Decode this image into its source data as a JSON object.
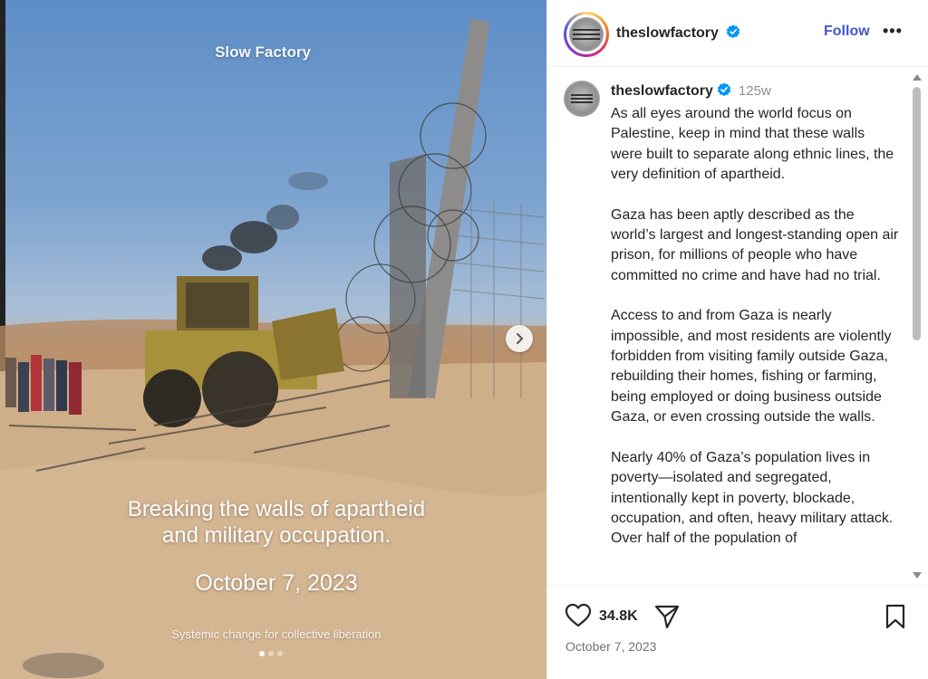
{
  "media": {
    "brand": "Slow Factory",
    "headline": "Breaking the walls of apartheid\nand military occupation.",
    "date": "October 7, 2023",
    "subtitle": "Systemic change for collective liberation",
    "carousel": {
      "count": 3,
      "active_index": 0
    }
  },
  "header": {
    "username": "theslowfactory",
    "verified": true,
    "follow_label": "Follow",
    "more_label": "•••"
  },
  "caption": {
    "username": "theslowfactory",
    "time": "125w",
    "paragraphs": [
      "As all eyes around the world focus on Palestine, keep in mind that these walls were built to separate along ethnic lines, the very definition of apartheid.",
      "Gaza has been aptly described as the world’s largest and longest-standing open air prison, for millions of people who have committed no crime and have had no trial.",
      "Access to and from Gaza is nearly impossible, and most residents are violently forbidden from visiting family outside Gaza, rebuilding their homes, fishing or farming, being employed or doing business outside Gaza, or even crossing outside the walls.",
      "Nearly 40% of Gaza’s population lives in poverty—isolated and segregated, intentionally kept in poverty, blockade, occupation, and often, heavy military attack. Over half of the population of"
    ]
  },
  "actions": {
    "likes": "34.8K",
    "date": "October 7, 2023"
  },
  "icons": {
    "verified": "verified-badge-icon",
    "like": "heart-icon",
    "share": "paper-plane-icon",
    "save": "bookmark-icon",
    "next": "chevron-right-icon"
  },
  "colors": {
    "verified": "#0095f6",
    "follow": "#3f58c9"
  }
}
